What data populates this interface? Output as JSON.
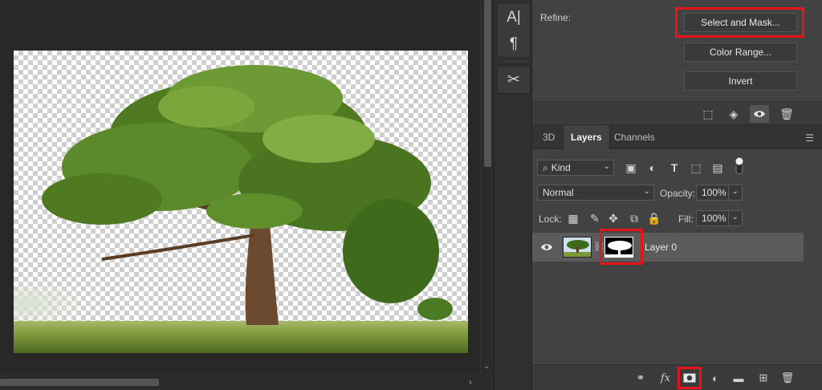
{
  "tools": {
    "type_icon_glyph": "A|",
    "paragraph_icon_glyph": "¶",
    "scissors_icon_glyph": "✂"
  },
  "properties": {
    "refine_label": "Refine:",
    "select_and_mask": "Select and Mask...",
    "color_range": "Color Range...",
    "invert": "Invert"
  },
  "tabs": {
    "items": [
      "3D",
      "Layers",
      "Channels"
    ],
    "active": "Layers"
  },
  "layers_panel": {
    "filter_kind": "Kind",
    "blend_mode": "Normal",
    "opacity_label": "Opacity:",
    "opacity_value": "100%",
    "lock_label": "Lock:",
    "fill_label": "Fill:",
    "fill_value": "100%",
    "layers": [
      {
        "name": "Layer 0",
        "visible": true,
        "has_mask": true
      }
    ]
  },
  "footer": {
    "fx_label": "fx"
  },
  "colors": {
    "highlight": "#e8141a",
    "panel_bg": "#424242",
    "canvas_bg": "#282828"
  }
}
